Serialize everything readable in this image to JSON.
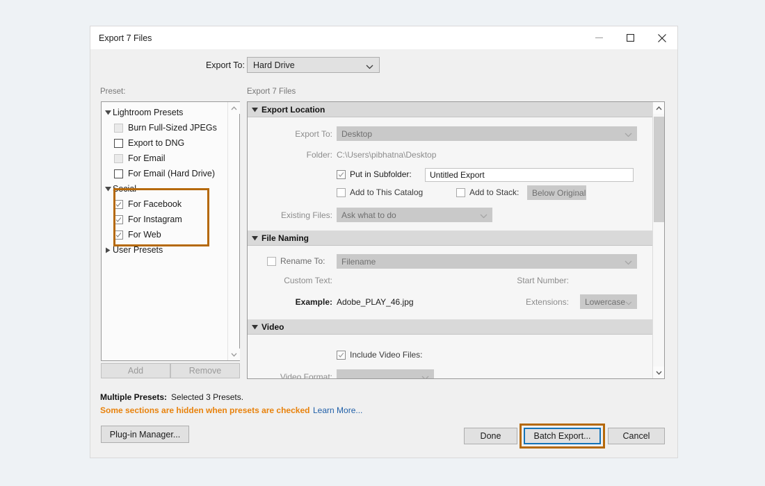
{
  "window": {
    "title": "Export 7 Files",
    "controls": [
      {
        "name": "minimize",
        "glyph": "minimize-icon"
      },
      {
        "name": "maximize",
        "glyph": "maximize-icon"
      },
      {
        "name": "close",
        "glyph": "close-icon"
      }
    ]
  },
  "top": {
    "export_to_label": "Export To:",
    "export_to_value": "Hard Drive"
  },
  "panes": {
    "preset_label": "Preset:",
    "files_label": "Export 7 Files"
  },
  "preset_tree": [
    {
      "type": "group",
      "label": "Lightroom Presets",
      "expanded": true
    },
    {
      "type": "item",
      "label": "Burn Full-Sized JPEGs",
      "checked": false,
      "enabled": false
    },
    {
      "type": "item",
      "label": "Export to DNG",
      "checked": false,
      "enabled": true
    },
    {
      "type": "item",
      "label": "For Email",
      "checked": false,
      "enabled": false
    },
    {
      "type": "item",
      "label": "For Email (Hard Drive)",
      "checked": false,
      "enabled": true
    },
    {
      "type": "group",
      "label": "Social",
      "expanded": true
    },
    {
      "type": "item",
      "label": "For Facebook",
      "checked": true,
      "enabled": true
    },
    {
      "type": "item",
      "label": "For Instagram",
      "checked": true,
      "enabled": true
    },
    {
      "type": "item",
      "label": "For Web",
      "checked": true,
      "enabled": true
    },
    {
      "type": "group",
      "label": "User Presets",
      "expanded": false
    }
  ],
  "preset_buttons": {
    "add": "Add",
    "remove": "Remove"
  },
  "sections": {
    "export_location": {
      "title": "Export Location",
      "export_to_label": "Export To:",
      "export_to_value": "Desktop",
      "folder_label": "Folder:",
      "folder_value": "C:\\Users\\pibhatna\\Desktop",
      "put_in_subfolder_label": "Put in Subfolder:",
      "subfolder_value": "Untitled Export",
      "add_to_catalog_label": "Add to This Catalog",
      "add_to_stack_label": "Add to Stack:",
      "stack_value": "Below Original",
      "existing_files_label": "Existing Files:",
      "existing_files_value": "Ask what to do"
    },
    "file_naming": {
      "title": "File Naming",
      "rename_to_label": "Rename To:",
      "rename_to_value": "Filename",
      "custom_text_label": "Custom Text:",
      "start_number_label": "Start Number:",
      "example_label": "Example:",
      "example_value": "Adobe_PLAY_46.jpg",
      "extensions_label": "Extensions:",
      "extensions_value": "Lowercase"
    },
    "video": {
      "title": "Video",
      "include_video_label": "Include Video Files:",
      "video_format_label": "Video Format:"
    }
  },
  "footer": {
    "multiple_presets_label": "Multiple Presets:",
    "multiple_presets_value": "Selected 3 Presets.",
    "warning": "Some sections are hidden when presets are checked",
    "learn_more": "Learn More...",
    "plugin_manager": "Plug-in Manager...",
    "done": "Done",
    "batch_export": "Batch Export...",
    "cancel": "Cancel"
  },
  "colors": {
    "annotation_orange": "#b5690a",
    "warning_orange": "#e8820c",
    "link_blue": "#1f5fa8",
    "focus_blue": "#1473b8"
  }
}
